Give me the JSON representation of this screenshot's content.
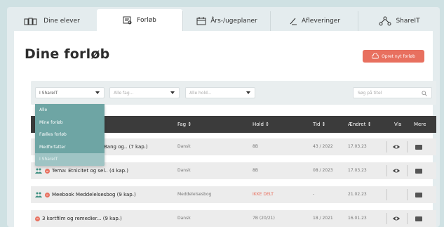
{
  "tabs": [
    {
      "label": "Dine elever",
      "icon": "students-icon"
    },
    {
      "label": "Forløb",
      "icon": "course-icon"
    },
    {
      "label": "Års-/ugeplaner",
      "icon": "calendar-icon"
    },
    {
      "label": "Afleveringer",
      "icon": "pencil-icon"
    },
    {
      "label": "ShareIT",
      "icon": "share-network-icon"
    }
  ],
  "active_tab": "Forløb",
  "page": {
    "title": "Dine forløb",
    "create_label": "Opret nyt forløb"
  },
  "filters": {
    "source_value": "I ShareIT",
    "subject_placeholder": "Alle fag...",
    "class_placeholder": "Alle hold...",
    "search_placeholder": "Søg på titel"
  },
  "dropdown": {
    "options": [
      "Alle",
      "Mine forløb",
      "Fælles forløb",
      "Medforfatter",
      "I ShareIT"
    ],
    "selected": "I ShareIT"
  },
  "table": {
    "headers": {
      "fag": "Fag ↕",
      "hold": "Hold ↕",
      "tid": "Tid ↕",
      "aendret": "Ændret ↕",
      "vis": "Vis",
      "mere": "Mere"
    },
    "rows": [
      {
        "title": "Bang og.. (7 kap.)",
        "fag": "Dansk",
        "hold": "8B",
        "tid": "43 / 2022",
        "aendret": "17.03.23"
      },
      {
        "title": "Tema: Etnicitet og sel.. (4 kap.)",
        "fag": "Dansk",
        "hold": "8B",
        "tid": "08 / 2023",
        "aendret": "17.03.23"
      },
      {
        "title": "Meebook Meddelelsesbog (9 kap.)",
        "fag": "Meddelelsesbog",
        "hold": "IKKE DELT",
        "tid": "-",
        "aendret": "21.02.23"
      },
      {
        "title": "3 kortfilm og remedier... (9 kap.)",
        "fag": "Dansk",
        "hold": "7B (20/21)",
        "tid": "18 / 2021",
        "aendret": "16.01.23"
      }
    ]
  },
  "colors": {
    "accent": "#e8705f",
    "header": "#3b3b3b",
    "dropdown": "#6ea5a4"
  }
}
